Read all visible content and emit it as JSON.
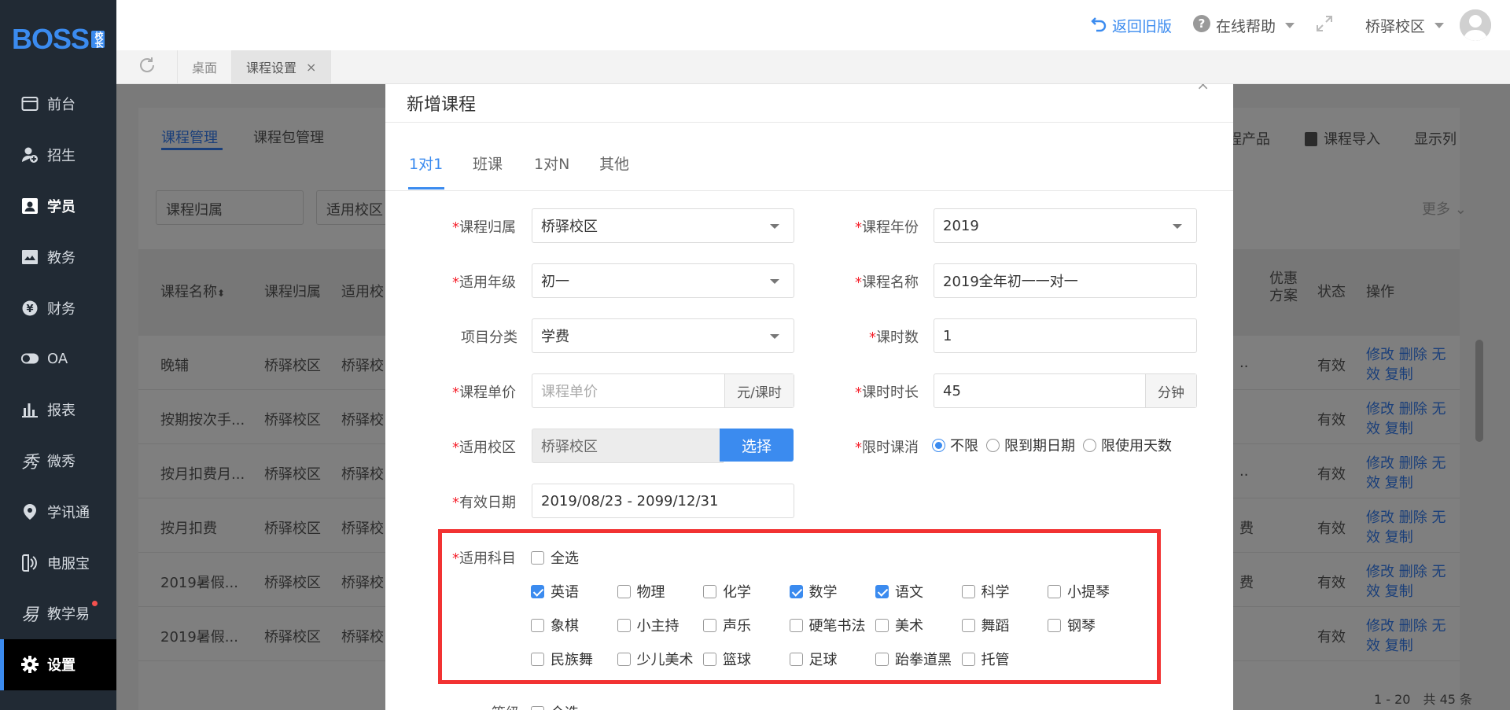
{
  "brand": {
    "logo": "BOSS",
    "logo_sub": "校长"
  },
  "sidebar": {
    "items": [
      {
        "label": "前台",
        "icon": "monitor-icon"
      },
      {
        "label": "招生",
        "icon": "user-add-icon"
      },
      {
        "label": "学员",
        "icon": "id-card-icon"
      },
      {
        "label": "教务",
        "icon": "book-icon"
      },
      {
        "label": "财务",
        "icon": "yen-icon"
      },
      {
        "label": "OA",
        "icon": "toggle-icon"
      },
      {
        "label": "报表",
        "icon": "bar-chart-icon"
      },
      {
        "label": "微秀",
        "icon": "xiu-icon"
      },
      {
        "label": "学讯通",
        "icon": "location-icon"
      },
      {
        "label": "电服宝",
        "icon": "phone-icon"
      },
      {
        "label": "教学易",
        "icon": "yi-icon"
      },
      {
        "label": "设置",
        "icon": "gear-icon"
      }
    ]
  },
  "topbar": {
    "back": "返回旧版",
    "help": "在线帮助",
    "campus": "桥驿校区"
  },
  "page_tabs": [
    {
      "label": "桌面"
    },
    {
      "label": "课程设置"
    }
  ],
  "bg": {
    "tab1": "课程管理",
    "tab2": "课程包管理",
    "tab3": "程产品",
    "import": "课程导入",
    "columns": "显示列",
    "filter1": "课程归属",
    "filter2": "适用校区",
    "more": "更多",
    "headers": {
      "name": "课程名称",
      "owner": "课程归属",
      "campus": "适用校",
      "discount": "优惠方案",
      "status": "状态",
      "ops": "操作"
    },
    "rows": [
      {
        "name": "晚辅",
        "owner": "桥驿校区",
        "campus": "桥驿校",
        "extra": "..",
        "status": "有效"
      },
      {
        "name": "按期按次手...",
        "owner": "桥驿校区",
        "campus": "桥驿校",
        "extra": "",
        "status": "有效"
      },
      {
        "name": "按月扣费月...",
        "owner": "桥驿校区",
        "campus": "桥驿校",
        "extra": "..",
        "status": "有效"
      },
      {
        "name": "按月扣费",
        "owner": "桥驿校区",
        "campus": "桥驿校",
        "extra": "费",
        "status": "有效"
      },
      {
        "name": "2019暑假...",
        "owner": "桥驿校区",
        "campus": "桥驿校",
        "extra": "费",
        "status": "有效"
      },
      {
        "name": "2019暑假...",
        "owner": "桥驿校区",
        "campus": "桥驿校",
        "extra": "",
        "status": "有效"
      }
    ],
    "ops_line1": "修改 删除 无",
    "ops_line2": "效 复制",
    "pagination": "1 - 20　共 45 条"
  },
  "modal": {
    "title": "新增课程",
    "close": "×",
    "tabs": [
      "1对1",
      "班课",
      "1对N",
      "其他"
    ],
    "form": {
      "owner_label": "课程归属",
      "owner_value": "桥驿校区",
      "year_label": "课程年份",
      "year_value": "2019",
      "grade_label": "适用年级",
      "grade_value": "初一",
      "name_label": "课程名称",
      "name_value": "2019全年初一一对一",
      "category_label": "项目分类",
      "category_value": "学费",
      "hours_label": "课时数",
      "hours_value": "1",
      "price_label": "课程单价",
      "price_placeholder": "课程单价",
      "price_unit": "元/课时",
      "duration_label": "课时时长",
      "duration_value": "45",
      "duration_unit": "分钟",
      "campus_label": "适用校区",
      "campus_value": "桥驿校区",
      "choose": "选择",
      "limit_label": "限时课消",
      "limit_options": [
        "不限",
        "限到期日期",
        "限使用天数"
      ],
      "date_label": "有效日期",
      "date_value": "2019/08/23 - 2099/12/31",
      "subject_label": "适用科目",
      "select_all": "全选",
      "subjects": [
        {
          "label": "英语",
          "checked": true
        },
        {
          "label": "物理",
          "checked": false
        },
        {
          "label": "化学",
          "checked": false
        },
        {
          "label": "数学",
          "checked": true
        },
        {
          "label": "语文",
          "checked": true
        },
        {
          "label": "科学",
          "checked": false
        },
        {
          "label": "小提琴",
          "checked": false
        },
        {
          "label": "象棋",
          "checked": false
        },
        {
          "label": "小主持",
          "checked": false
        },
        {
          "label": "声乐",
          "checked": false
        },
        {
          "label": "硬笔书法",
          "checked": false
        },
        {
          "label": "美术",
          "checked": false
        },
        {
          "label": "舞蹈",
          "checked": false
        },
        {
          "label": "钢琴",
          "checked": false
        },
        {
          "label": "民族舞",
          "checked": false
        },
        {
          "label": "少儿美术",
          "checked": false
        },
        {
          "label": "篮球",
          "checked": false
        },
        {
          "label": "足球",
          "checked": false
        },
        {
          "label": "跆拳道黑",
          "checked": false
        },
        {
          "label": "托管",
          "checked": false
        }
      ],
      "level_label": "等级",
      "level_select_all": "全选"
    }
  },
  "colors": {
    "accent": "#3b8bef",
    "sidebar_bg": "#212a34",
    "highlight": "#f23232"
  }
}
